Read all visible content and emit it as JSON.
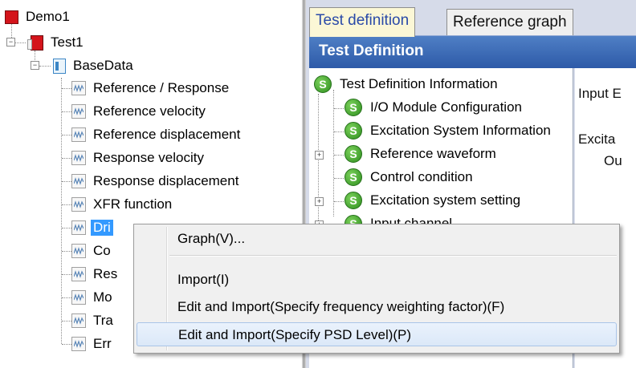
{
  "tree": {
    "root": "Demo1",
    "test": "Test1",
    "base": "BaseData",
    "items": [
      "Reference / Response",
      "Reference velocity",
      "Reference displacement",
      "Response velocity",
      "Response displacement",
      "XFR function",
      "Dri",
      "Co",
      "Res",
      "Mo",
      "Tra",
      "Err"
    ]
  },
  "tabs": [
    {
      "label": "Test definition",
      "active": true
    },
    {
      "label": "Reference graph",
      "active": false
    }
  ],
  "panel_title": "Test Definition",
  "definition_tree": [
    {
      "label": "Test Definition Information",
      "expander": ""
    },
    {
      "label": "I/O Module Configuration",
      "expander": ""
    },
    {
      "label": "Excitation System Information",
      "expander": ""
    },
    {
      "label": "Reference waveform",
      "expander": "+"
    },
    {
      "label": "Control condition",
      "expander": ""
    },
    {
      "label": "Excitation system setting",
      "expander": "+"
    },
    {
      "label": "Input channel",
      "expander": "+"
    }
  ],
  "detail_labels": [
    "Input E",
    "Excita",
    "Ou"
  ],
  "context_menu": {
    "items": [
      "Graph(V)...",
      "Import(I)",
      "Edit and Import(Specify frequency weighting factor)(F)",
      "Edit and Import(Specify PSD Level)(P)"
    ],
    "highlighted_index": 3
  },
  "colors": {
    "selection": "#3399ff",
    "header_bar": "#2d5aa8",
    "active_tab_bg": "#fbf7d6",
    "active_tab_text": "#2a4aa8",
    "status_icon": "#2f8f1f"
  }
}
